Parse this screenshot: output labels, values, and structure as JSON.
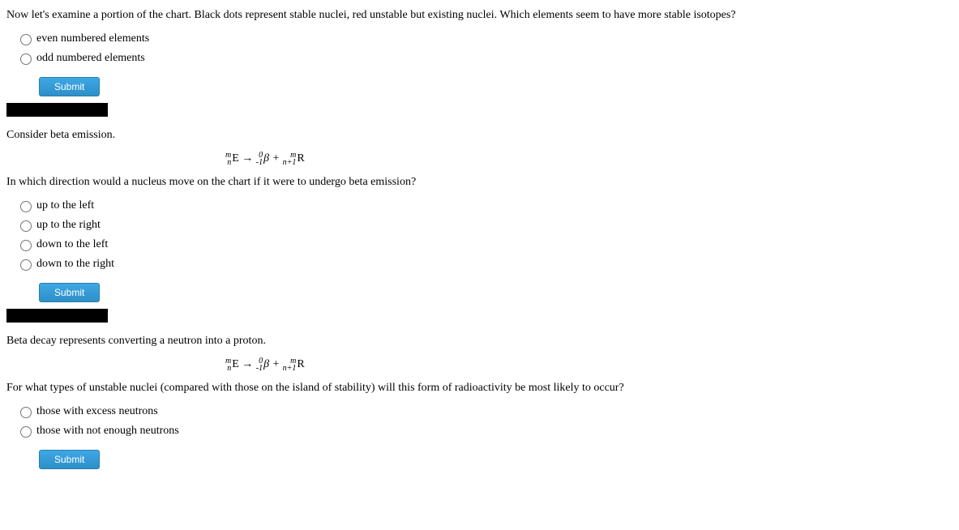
{
  "q1": {
    "text": "Now let's examine a portion of the chart. Black dots represent stable nuclei, red unstable but existing nuclei. Which elements seem to have more stable isotopes?",
    "options": [
      "even numbered elements",
      "odd numbered elements"
    ],
    "submit": "Submit"
  },
  "q2": {
    "intro": "Consider beta emission.",
    "text": "In which direction would a nucleus move on the chart if it were to undergo beta emission?",
    "options": [
      "up to the left",
      "up to the right",
      "down to the left",
      "down to the right"
    ],
    "submit": "Submit"
  },
  "q3": {
    "intro": "Beta decay represents converting a neutron into a proton.",
    "text": "For what types of unstable nuclei (compared with those on the island of stability) will this form of radioactivity be most likely to occur?",
    "options": [
      "those with excess neutrons",
      "those with not enough neutrons"
    ],
    "submit": "Submit"
  },
  "equation": {
    "e_top": "m",
    "e_bot": "n",
    "e_sym": "E",
    "arrow": "→",
    "b_top": "0",
    "b_bot": "-1",
    "b_sym": "β",
    "plus": "+",
    "r_top": "m",
    "r_bot": "n+1",
    "r_sym": "R"
  }
}
